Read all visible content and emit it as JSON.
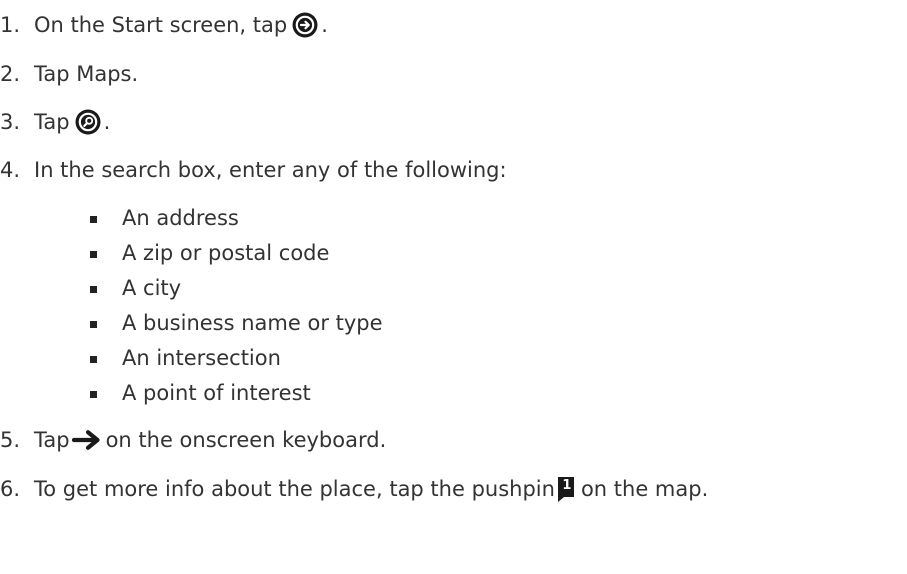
{
  "steps": [
    {
      "num": "1.",
      "before": "On the Start screen, tap ",
      "icon": "arrow-circle-icon",
      "after": "."
    },
    {
      "num": "2.",
      "text": "Tap Maps."
    },
    {
      "num": "3.",
      "before": "Tap ",
      "icon": "search-circle-icon",
      "after": "."
    },
    {
      "num": "4.",
      "text": "In the search box, enter any of the following:"
    },
    {
      "num": "5.",
      "before": "Tap ",
      "icon": "right-arrow-icon",
      "after": " on the onscreen keyboard."
    },
    {
      "num": "6.",
      "before": "To get more info about the place, tap the pushpin ",
      "icon": "pushpin-icon",
      "after": " on the map."
    }
  ],
  "search_options": [
    "An address",
    "A zip or postal code",
    "A city",
    "A business name or type",
    "An intersection",
    "A point of interest"
  ],
  "pushpin_label": "1",
  "colors": {
    "text": "#333333",
    "icon": "#1a1a1a"
  }
}
